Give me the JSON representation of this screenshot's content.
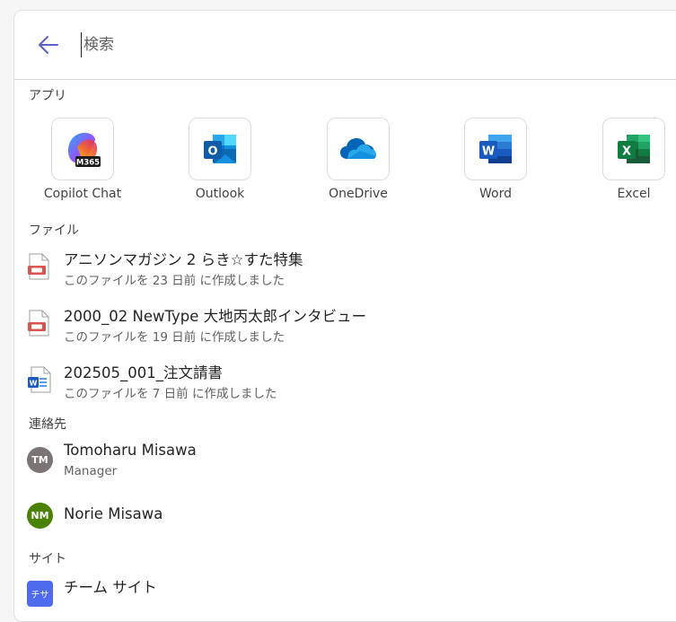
{
  "search": {
    "placeholder": "検索",
    "value": ""
  },
  "sections": {
    "apps": "アプリ",
    "files": "ファイル",
    "contacts": "連絡先",
    "sites": "サイト"
  },
  "apps": [
    {
      "name": "Copilot Chat",
      "icon": "copilot-m365-icon",
      "badge": "M365"
    },
    {
      "name": "Outlook",
      "icon": "outlook-icon"
    },
    {
      "name": "OneDrive",
      "icon": "onedrive-icon"
    },
    {
      "name": "Word",
      "icon": "word-icon"
    },
    {
      "name": "Excel",
      "icon": "excel-icon"
    }
  ],
  "files": [
    {
      "title": "アニソンマガジン 2 らき☆すた特集",
      "subtitle": "このファイルを 23 日前 に作成しました",
      "icon": "pdf-file-icon"
    },
    {
      "title": "2000_02 NewType 大地丙太郎インタビュー",
      "subtitle": "このファイルを 19 日前 に作成しました",
      "icon": "pdf-file-icon"
    },
    {
      "title": "202505_001_注文請書",
      "subtitle": "このファイルを 7 日前 に作成しました",
      "icon": "word-file-icon"
    }
  ],
  "contacts": [
    {
      "name": "Tomoharu Misawa",
      "role": "Manager",
      "initials": "TM",
      "color": "#7a7574"
    },
    {
      "name": "Norie Misawa",
      "role": "",
      "initials": "NM",
      "color": "#498205"
    }
  ],
  "sites": [
    {
      "name": "チーム サイト",
      "initials": "チサ",
      "color": "#4f6bed"
    }
  ],
  "colors": {
    "accent": "#5b5fc7"
  }
}
